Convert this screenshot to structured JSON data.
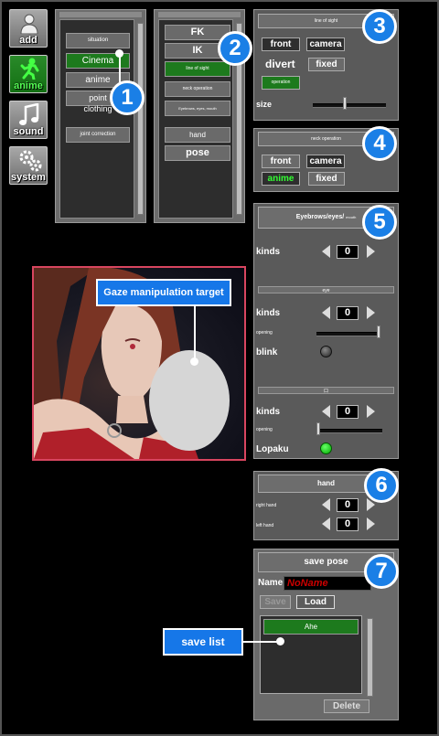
{
  "sidebar": {
    "add": "add",
    "anime": "anime",
    "sound": "sound",
    "system": "system"
  },
  "list1": {
    "items": [
      "situation",
      "Cinema",
      "anime",
      "point",
      "clothing",
      "joint correction"
    ]
  },
  "list2": {
    "items": [
      "FK",
      "IK",
      "line of sight",
      "neck operation",
      "Eyebrows, eyes, mouth",
      "hand",
      "pose"
    ]
  },
  "gaze": {
    "title": "line of sight",
    "front": "front",
    "camera": "camera",
    "divert": "divert",
    "fixed": "fixed",
    "operation": "operation",
    "size": "size"
  },
  "neck": {
    "title": "neck operation",
    "front": "front",
    "camera": "camera",
    "anime": "anime",
    "fixed": "fixed"
  },
  "face": {
    "title": "Eyebrows/eyes/",
    "title_suffix": "mouth",
    "brow_kinds": "kinds",
    "brow_value": "0",
    "eye_title": "eye",
    "eye_kinds": "kinds",
    "eye_value": "0",
    "eye_opening": "opening",
    "blink": "blink",
    "mouth_title": "口",
    "mouth_kinds": "kinds",
    "mouth_value": "0",
    "mouth_opening": "opening",
    "lipsync": "Lopaku",
    "eye_opening_level": 1.0,
    "mouth_opening_level": 0.0
  },
  "hand": {
    "title": "hand",
    "right": "right hand",
    "left": "left hand",
    "right_value": "0",
    "left_value": "0"
  },
  "save_pose": {
    "title": "save pose",
    "name_label": "Name",
    "name_value": "NoName",
    "save": "Save",
    "load": "Load",
    "list_item": "Ahe",
    "delete": "Delete"
  },
  "callouts": {
    "gaze_target": "Gaze manipulation target",
    "save_list": "save list"
  },
  "badges": [
    "1",
    "2",
    "3",
    "4",
    "5",
    "6",
    "7"
  ],
  "colors": {
    "badge": "#1a7fe6",
    "selected": "#1d7a1d",
    "preview_border": "#d8455f"
  }
}
